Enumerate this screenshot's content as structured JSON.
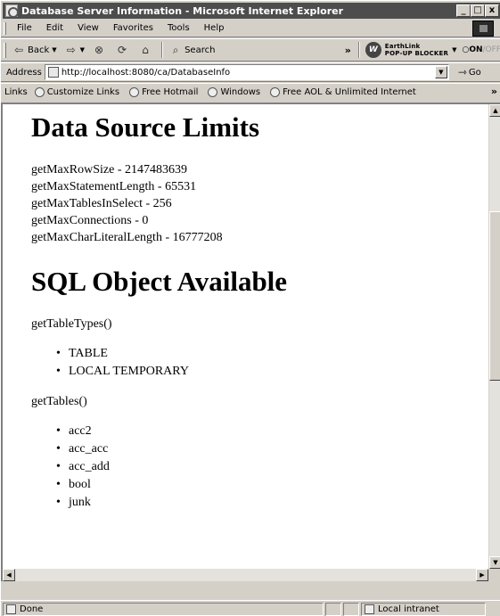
{
  "window": {
    "title": "Database Server Information - Microsoft Internet Explorer",
    "controls": {
      "minimize": "_",
      "maximize": "□",
      "close": "x"
    }
  },
  "menu": {
    "items": [
      "File",
      "Edit",
      "View",
      "Favorites",
      "Tools",
      "Help"
    ]
  },
  "toolbar": {
    "back_label": "Back",
    "search_label": "Search",
    "chevron": "»",
    "earthlink_line1": "EarthLink",
    "earthlink_line2": "POP-UP BLOCKER",
    "on_label": "ON",
    "off_label": "/OFF"
  },
  "address": {
    "label": "Address",
    "url": "http://localhost:8080/ca/DatabaseInfo",
    "go_label": "Go"
  },
  "links": {
    "label": "Links",
    "items": [
      "Customize Links",
      "Free Hotmail",
      "Windows",
      "Free AOL & Unlimited Internet"
    ],
    "more": "»"
  },
  "page": {
    "heading1": "Data Source Limits",
    "limits": [
      "getMaxRowSize - 2147483639",
      "getMaxStatementLength - 65531",
      "getMaxTablesInSelect - 256",
      "getMaxConnections - 0",
      "getMaxCharLiteralLength - 16777208"
    ],
    "heading2": "SQL Object Available",
    "table_types_label": "getTableTypes()",
    "table_types": [
      "TABLE",
      "LOCAL TEMPORARY"
    ],
    "tables_label": "getTables()",
    "tables": [
      "acc2",
      "acc_acc",
      "acc_add",
      "bool",
      "junk"
    ]
  },
  "status": {
    "text": "Done",
    "zone": "Local intranet"
  }
}
